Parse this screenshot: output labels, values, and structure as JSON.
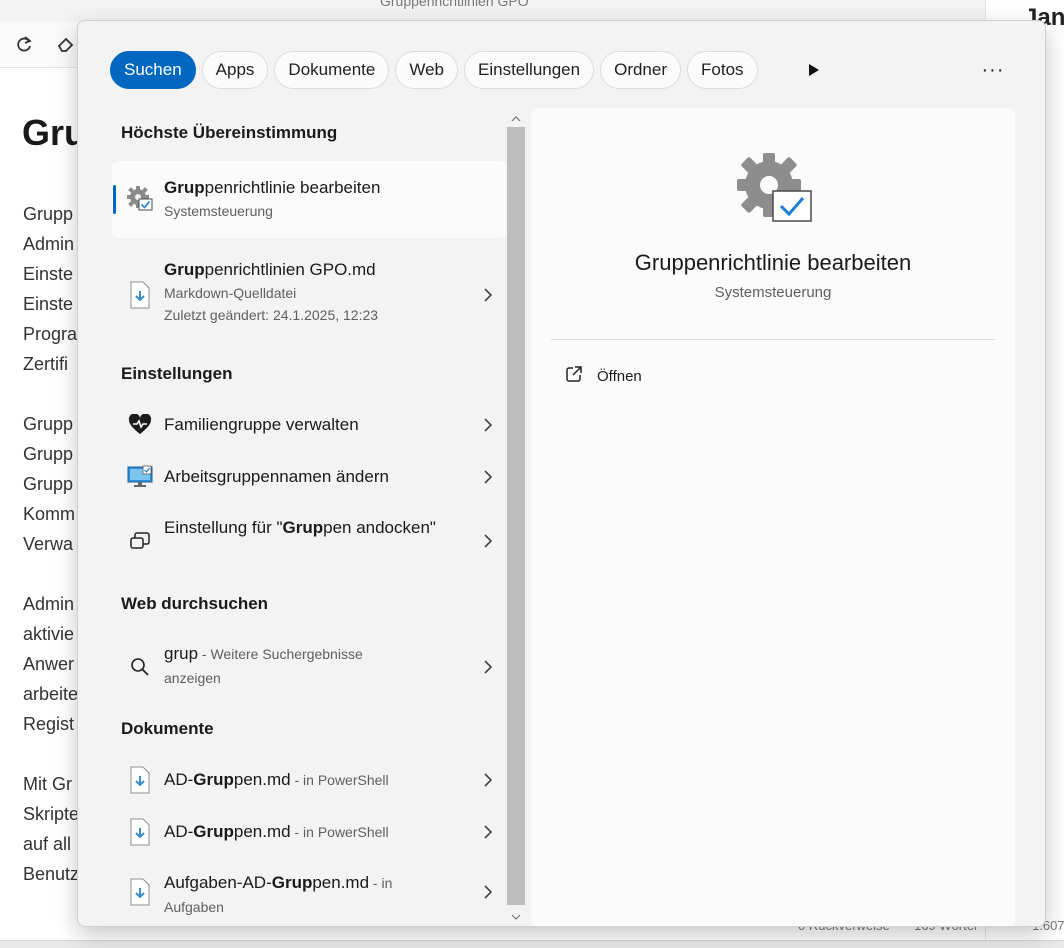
{
  "background": {
    "title": "Gruppenrichtlinien GPO",
    "heading": "Gru",
    "paragraph_fragments": [
      "Grupp",
      "Admin",
      "Einste",
      "Einste",
      "Progra",
      "Zertifi",
      "Grupp",
      "Grupp",
      "Grupp",
      "Komm",
      "Verwa",
      "Admin",
      "aktivie",
      "Anwer",
      "arbeite",
      "Regist",
      "Mit Gr",
      "Skripte",
      "auf all",
      "Benutz"
    ],
    "right_text": "Jan.",
    "status": {
      "backlinks": "0 Rückverweise",
      "words": "169 Wörter",
      "chars": "1.607"
    }
  },
  "search": {
    "filters": [
      {
        "label": "Suchen",
        "active": true
      },
      {
        "label": "Apps",
        "active": false
      },
      {
        "label": "Dokumente",
        "active": false
      },
      {
        "label": "Web",
        "active": false
      },
      {
        "label": "Einstellungen",
        "active": false
      },
      {
        "label": "Ordner",
        "active": false
      },
      {
        "label": "Fotos",
        "active": false
      }
    ],
    "more_label": "···",
    "sections": {
      "best_match": "Höchste Übereinstimmung",
      "settings": "Einstellungen",
      "web": "Web durchsuchen",
      "documents": "Dokumente"
    },
    "best_match": [
      {
        "bold": "Grup",
        "rest": "penrichtlinie bearbeiten",
        "sub": "Systemsteuerung"
      },
      {
        "bold": "Grup",
        "rest": "penrichtlinien GPO.md",
        "sub": "Markdown-Quelldatei",
        "sub2": "Zuletzt geändert: 24.1.2025, 12:23"
      }
    ],
    "settings_items": [
      {
        "text": "Familiengruppe verwalten"
      },
      {
        "text": "Arbeitsgruppennamen ändern"
      },
      {
        "pre": "Einstellung für \"",
        "bold": "Grup",
        "post": "pen andocken\""
      }
    ],
    "web_item": {
      "query": "grup",
      "sub_inline": " - Weitere Suchergebnisse",
      "sub_line2": "anzeigen"
    },
    "document_items": [
      {
        "pre": "AD-",
        "bold": "Grup",
        "post": "pen.md",
        "location": " - in PowerShell"
      },
      {
        "pre": "AD-",
        "bold": "Grup",
        "post": "pen.md",
        "location": " - in PowerShell"
      },
      {
        "pre": "Aufgaben-AD-",
        "bold": "Grup",
        "post": "pen.md",
        "location": " - in",
        "location2": "Aufgaben"
      }
    ],
    "preview": {
      "title": "Gruppenrichtlinie bearbeiten",
      "subtitle": "Systemsteuerung",
      "open_label": "Öffnen"
    },
    "colors": {
      "accent": "#0067c0",
      "panel": "#f3f3f3",
      "card": "#fbfbfb"
    }
  }
}
